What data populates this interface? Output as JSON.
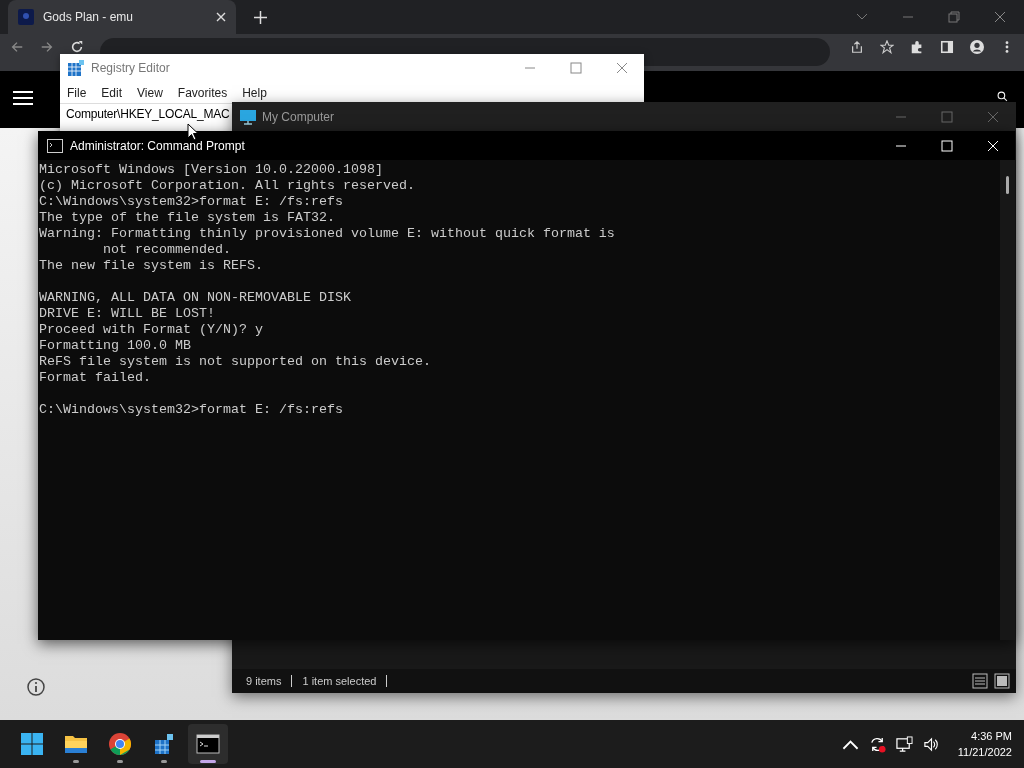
{
  "browser": {
    "tab": {
      "title": "Gods Plan - emu"
    }
  },
  "registry_editor": {
    "title": "Registry Editor",
    "menu": [
      "File",
      "Edit",
      "View",
      "Favorites",
      "Help"
    ],
    "address": "Computer\\HKEY_LOCAL_MAC"
  },
  "my_computer": {
    "title": "My Computer",
    "status": [
      "9 items",
      "1 item selected"
    ]
  },
  "command_prompt": {
    "title": "Administrator: Command Prompt",
    "blocks": [
      [
        "Microsoft Windows [Version 10.0.22000.1098]",
        "(c) Microsoft Corporation. All rights reserved.",
        "C:\\Windows\\system32>format E: /fs:refs",
        "The type of the file system is FAT32.",
        "Warning: Formatting thinly provisioned volume E: without quick format is",
        "        not recommended.",
        "The new file system is REFS."
      ],
      [
        "WARNING, ALL DATA ON NON-REMOVABLE DISK",
        "DRIVE E: WILL BE LOST!",
        "Proceed with Format (Y/N)? y",
        "Formatting 100.0 MB",
        "ReFS file system is not supported on this device.",
        "Format failed."
      ],
      [
        "C:\\Windows\\system32>format E: /fs:refs"
      ]
    ]
  },
  "taskbar": {
    "apps": [
      {
        "kind": "start",
        "running": false,
        "selected": false
      },
      {
        "kind": "explorer",
        "running": true,
        "selected": false
      },
      {
        "kind": "chrome",
        "running": true,
        "selected": false
      },
      {
        "kind": "registry",
        "running": true,
        "selected": false
      },
      {
        "kind": "terminal",
        "running": true,
        "selected": true
      }
    ],
    "time": "4:36 PM",
    "date": "11/21/2022"
  }
}
